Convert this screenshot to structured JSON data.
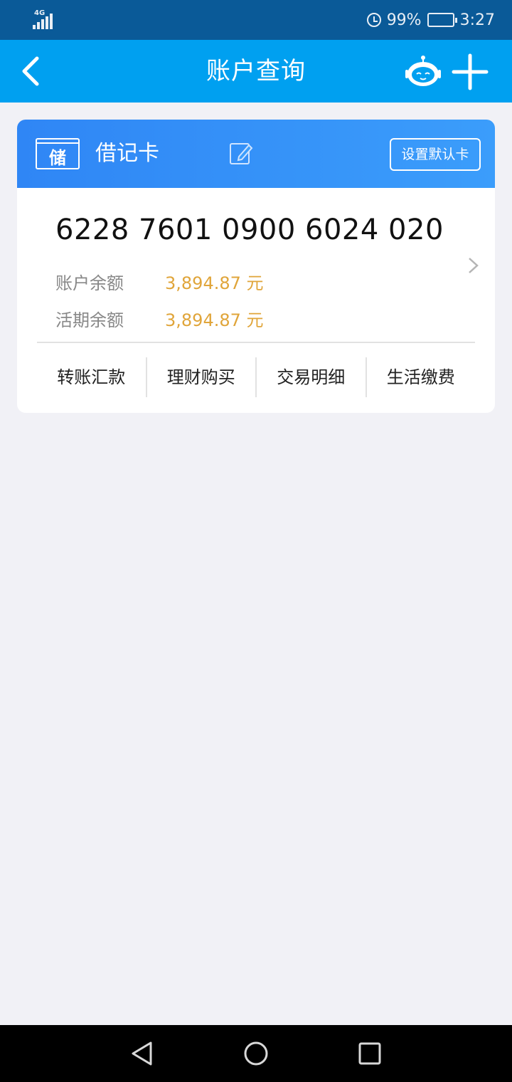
{
  "status_bar": {
    "network": "4G",
    "battery": "99%",
    "time": "3:27"
  },
  "header": {
    "title": "账户查询"
  },
  "card": {
    "type_badge": "储",
    "type_label": "借记卡",
    "set_default_label": "设置默认卡",
    "number": "6228 7601 0900 6024 020",
    "balances": [
      {
        "label": "账户余额",
        "value": "3,894.87 元"
      },
      {
        "label": "活期余额",
        "value": "3,894.87 元"
      }
    ],
    "actions": [
      {
        "label": "转账汇款"
      },
      {
        "label": "理财购买"
      },
      {
        "label": "交易明细"
      },
      {
        "label": "生活缴费"
      }
    ]
  },
  "colors": {
    "status_bar_bg": "#0a5a98",
    "header_bg": "#00a0f0",
    "card_head_bg": "#2f86f5",
    "balance_value": "#e0a53a",
    "page_bg": "#f1f1f6"
  }
}
